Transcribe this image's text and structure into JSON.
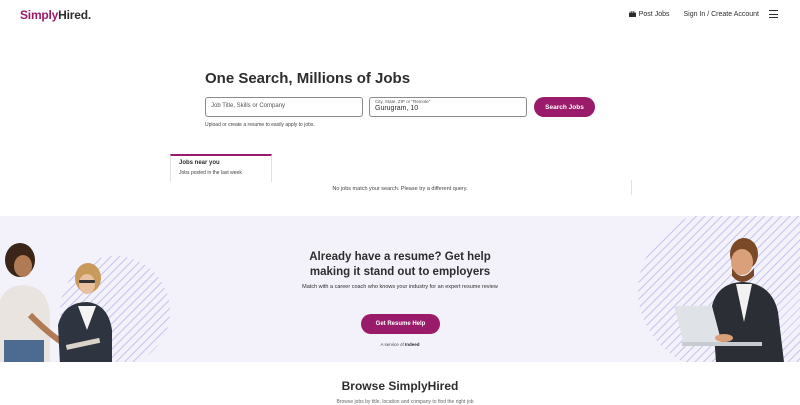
{
  "header": {
    "logo_simply": "Simply",
    "logo_hired": "Hired.",
    "post_jobs": "Post Jobs",
    "sign_in": "Sign In / Create Account"
  },
  "search": {
    "title": "One Search, Millions of Jobs",
    "what_placeholder": "Job Title, Skills or Company",
    "where_label": "City, State, ZIP or \"Remote\"",
    "where_value": "Gurugram, 10",
    "button": "Search Jobs",
    "upload_hint": "Upload or create a resume to easily apply to jobs."
  },
  "results": {
    "tab_title": "Jobs near you",
    "tab_subtitle": "Jobs posted in the last week",
    "empty_message": "No jobs match your search. Please try a different query."
  },
  "banner": {
    "title_line1": "Already have a resume? Get help",
    "title_line2": "making it stand out to employers",
    "subtitle": "Match with a career coach who knows your industry for an expert resume review",
    "button": "Get Resume Help",
    "service_prefix": "A service of",
    "service_brand": "Indeed"
  },
  "browse": {
    "title": "Browse SimplyHired",
    "subtitle": "Browse jobs by title, location and company to find the right job"
  },
  "colors": {
    "brand": "#9a1b6a",
    "banner_bg": "#f3f2fb",
    "stripe": "#c9c4ee"
  },
  "icons": {
    "post_jobs": "briefcase-icon",
    "menu": "hamburger-menu-icon"
  }
}
